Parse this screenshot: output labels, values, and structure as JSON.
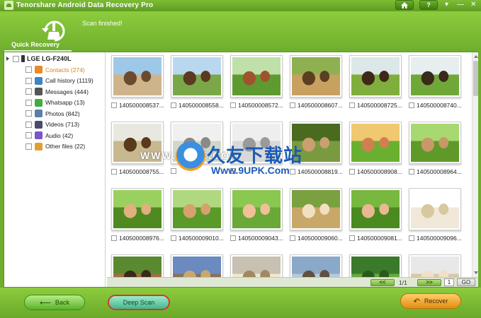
{
  "window": {
    "title": "Tenorshare Android Data Recovery Pro",
    "controls": [
      "home-icon",
      "help-icon",
      "menu-chevron-icon",
      "minimize-icon",
      "close-icon"
    ],
    "help_label": "?"
  },
  "header": {
    "mode_label": "Quick Recovery",
    "status": "Scan finished!"
  },
  "sidebar": {
    "device": "LGE LG-F240L",
    "categories": [
      {
        "label": "Contacts (274)",
        "icon": "contacts-icon",
        "color": "#e98a2a",
        "active": true
      },
      {
        "label": "Call history (1119)",
        "icon": "call-history-icon",
        "color": "#3d85c6"
      },
      {
        "label": "Messages (444)",
        "icon": "messages-icon",
        "color": "#555555"
      },
      {
        "label": "Whatsapp (13)",
        "icon": "whatsapp-icon",
        "color": "#3fae3f"
      },
      {
        "label": "Photos (842)",
        "icon": "photos-icon",
        "color": "#5a7fa8"
      },
      {
        "label": "Videos (713)",
        "icon": "videos-icon",
        "color": "#4a4a6a"
      },
      {
        "label": "Audio (42)",
        "icon": "audio-icon",
        "color": "#7a55c8"
      },
      {
        "label": "Other files (22)",
        "icon": "other-files-icon",
        "color": "#e0a030"
      }
    ]
  },
  "photos": [
    {
      "caption": "140500008537..."
    },
    {
      "caption": "140500008558..."
    },
    {
      "caption": "140500008572..."
    },
    {
      "caption": "140500008607..."
    },
    {
      "caption": "140500008725..."
    },
    {
      "caption": "140500008740..."
    },
    {
      "caption": "140500008755..."
    },
    {
      "caption": ""
    },
    {
      "caption": ""
    },
    {
      "caption": "140500008819..."
    },
    {
      "caption": "140500008908..."
    },
    {
      "caption": "140500008964..."
    },
    {
      "caption": "140500008976..."
    },
    {
      "caption": "140500009010..."
    },
    {
      "caption": "140500009043..."
    },
    {
      "caption": "140500009060..."
    },
    {
      "caption": "140500009081..."
    },
    {
      "caption": "140500009096..."
    },
    {
      "caption": ""
    },
    {
      "caption": ""
    },
    {
      "caption": ""
    },
    {
      "caption": ""
    },
    {
      "caption": ""
    },
    {
      "caption": ""
    }
  ],
  "pager": {
    "prev_label": "<<",
    "next_label": ">>",
    "page_info": "1/1",
    "page_input": "1",
    "go_label": "GO"
  },
  "footer": {
    "back_label": "Back",
    "deep_scan_label": "Deep Scan",
    "recover_label": "Recover"
  },
  "watermark": {
    "url_text": "WWW.9UPK.COM",
    "cn_text": "久友下载站",
    "url_text2": "Www.9UPK.Com"
  }
}
